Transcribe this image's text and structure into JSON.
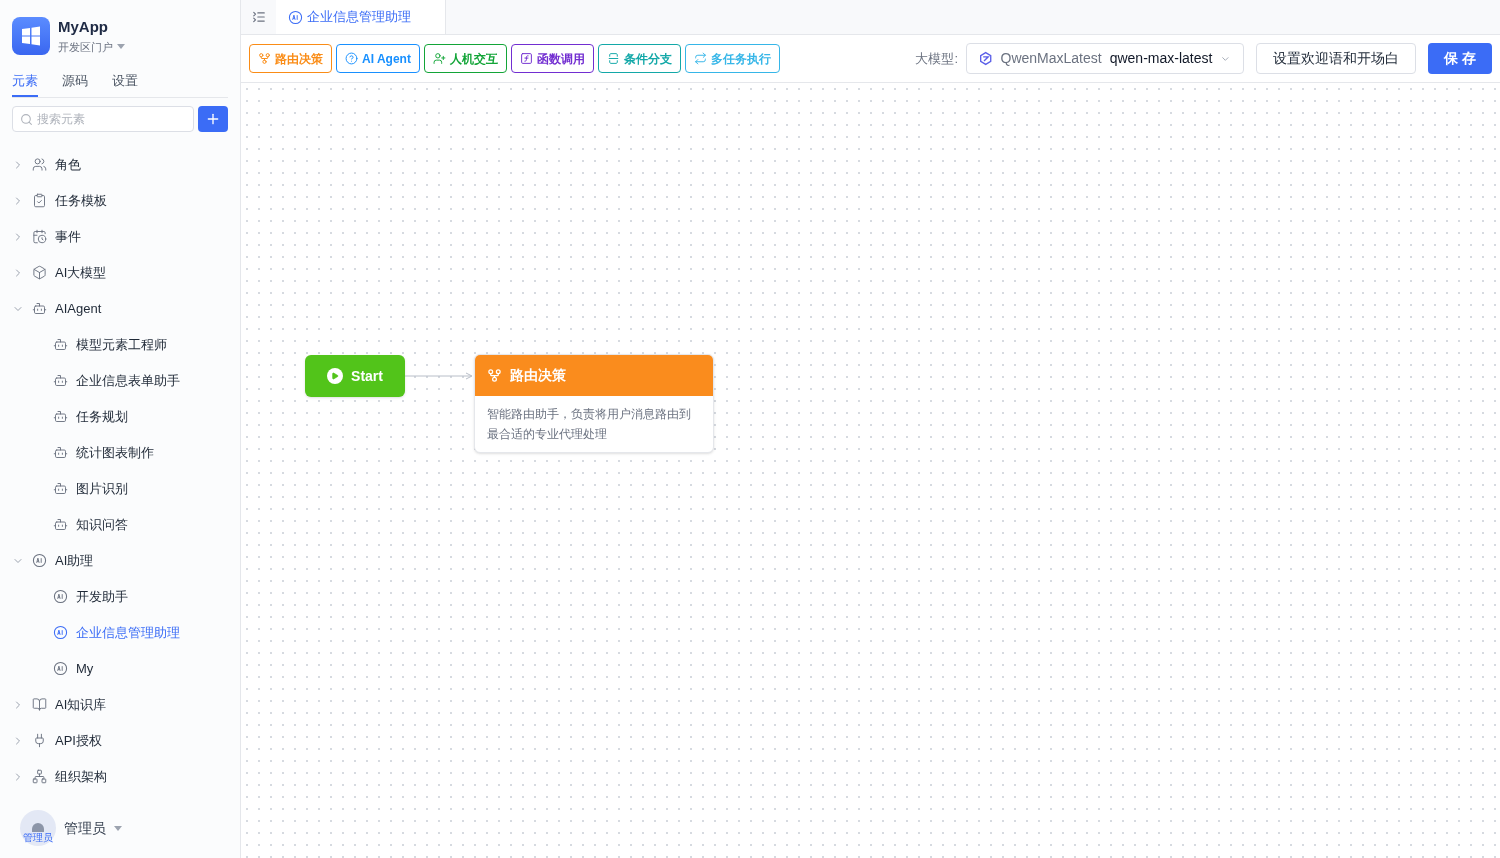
{
  "app": {
    "name": "MyApp",
    "portal": "开发区门户"
  },
  "sidebar_tabs": [
    {
      "label": "元素",
      "selected": true
    },
    {
      "label": "源码",
      "selected": false
    },
    {
      "label": "设置",
      "selected": false
    }
  ],
  "search": {
    "placeholder": "搜索元素"
  },
  "tree": [
    {
      "label": "角色",
      "kind": "role",
      "expanded": false
    },
    {
      "label": "任务模板",
      "kind": "template",
      "expanded": false
    },
    {
      "label": "事件",
      "kind": "event",
      "expanded": false
    },
    {
      "label": "AI大模型",
      "kind": "model",
      "expanded": false
    },
    {
      "label": "AIAgent",
      "kind": "agent",
      "expanded": true,
      "children": [
        {
          "label": "模型元素工程师",
          "kind": "agent",
          "selected": false
        },
        {
          "label": "企业信息表单助手",
          "kind": "agent",
          "selected": false
        },
        {
          "label": "任务规划",
          "kind": "agent",
          "selected": false
        },
        {
          "label": "统计图表制作",
          "kind": "agent",
          "selected": false
        },
        {
          "label": "图片识别",
          "kind": "agent",
          "selected": false
        },
        {
          "label": "知识问答",
          "kind": "agent",
          "selected": false
        }
      ]
    },
    {
      "label": "AI助理",
      "kind": "assistant",
      "expanded": true,
      "children": [
        {
          "label": "开发助手",
          "kind": "assistant",
          "selected": false
        },
        {
          "label": "企业信息管理助理",
          "kind": "assistant",
          "selected": true
        },
        {
          "label": "My",
          "kind": "assistant",
          "selected": false
        }
      ]
    },
    {
      "label": "AI知识库",
      "kind": "kb",
      "expanded": false
    },
    {
      "label": "API授权",
      "kind": "api",
      "expanded": false
    },
    {
      "label": "组织架构",
      "kind": "org",
      "expanded": false
    }
  ],
  "user": {
    "name": "管理员",
    "avatar_label": "管理员"
  },
  "open_tab": {
    "label": "企业信息管理助理"
  },
  "node_buttons": [
    {
      "label": "路由决策",
      "kind": "router",
      "color": "#fa8c16"
    },
    {
      "label": "AI Agent",
      "kind": "agent",
      "color": "#1890ff"
    },
    {
      "label": "人机交互",
      "kind": "human",
      "color": "#13a538"
    },
    {
      "label": "函数调用",
      "kind": "function",
      "color": "#722ed1"
    },
    {
      "label": "条件分支",
      "kind": "condition",
      "color": "#13a8a8"
    },
    {
      "label": "多任务执行",
      "kind": "multi",
      "color": "#36b6e8"
    }
  ],
  "model": {
    "label": "大模型:",
    "name": "QwenMaxLatest",
    "value": "qwen-max-latest"
  },
  "welcome_button": "设置欢迎语和开场白",
  "save_button": "保 存",
  "canvas": {
    "start": {
      "label": "Start"
    },
    "router": {
      "title": "路由决策",
      "description": "智能路由助手，负责将用户消息路由到最合适的专业代理处理"
    }
  }
}
